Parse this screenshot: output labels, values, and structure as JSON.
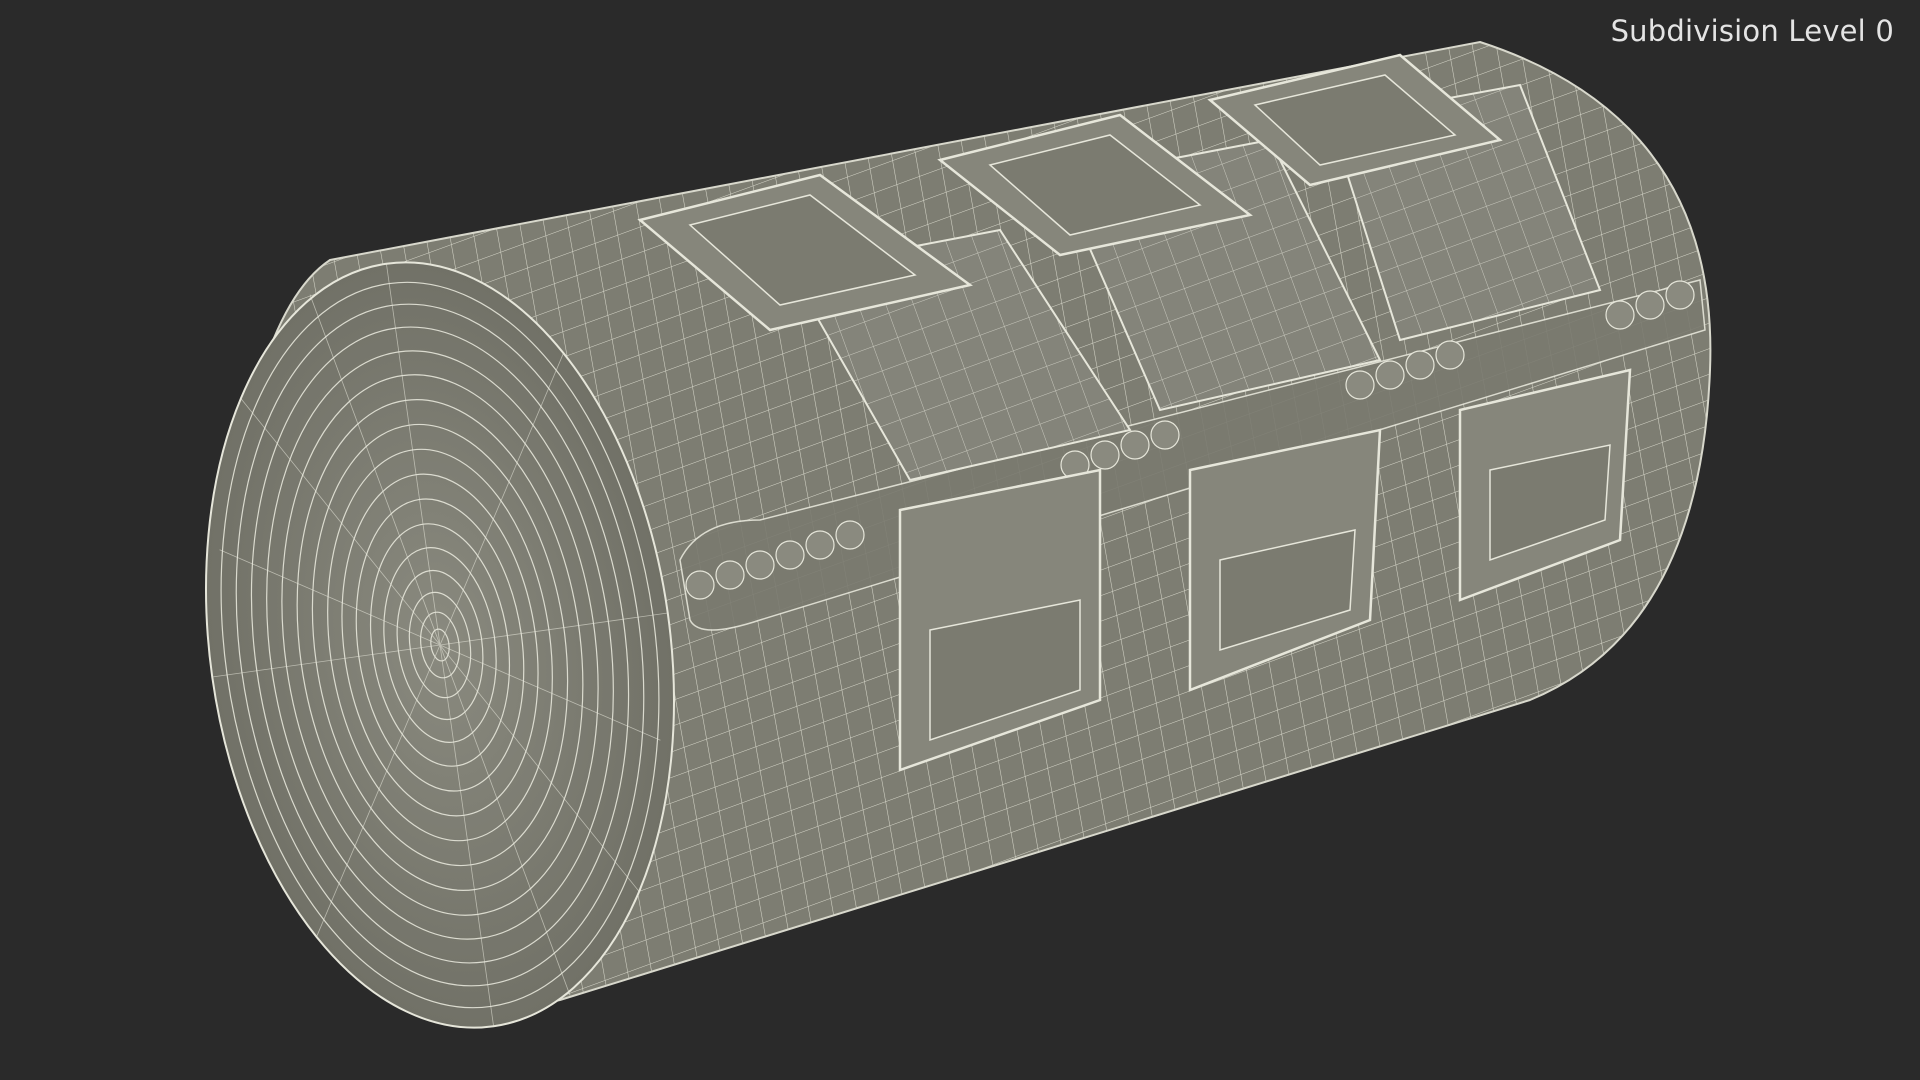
{
  "viewport": {
    "label": "Subdivision Level 0",
    "background_color": "#2a2a2a",
    "model_color": "#7f7f74",
    "wire_color": "#e8e8dc"
  },
  "model": {
    "name": "elastic-bandage-roll-with-clips",
    "clip_count": 3
  }
}
